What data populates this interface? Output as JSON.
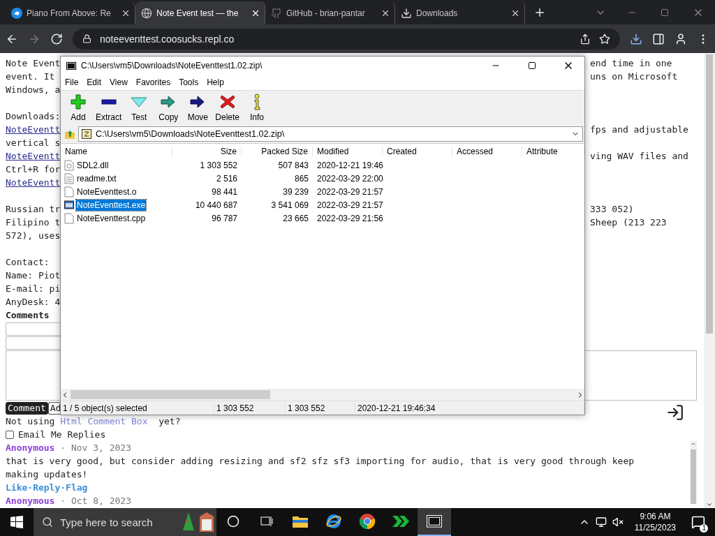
{
  "browser": {
    "tabs": [
      {
        "title": "Piano From Above: Re",
        "kind": "piano",
        "selected": false
      },
      {
        "title": "Note Event test — the",
        "kind": "globe",
        "selected": true
      },
      {
        "title": "GitHub - brian-pantar",
        "kind": "github",
        "selected": false
      },
      {
        "title": "Downloads",
        "kind": "download",
        "selected": false
      }
    ],
    "nav": [
      {
        "kind": "back",
        "disabled": false
      },
      {
        "kind": "forward",
        "disabled": true
      },
      {
        "kind": "reload",
        "disabled": false
      }
    ],
    "address": "noteeventtest.coosucks.repl.co"
  },
  "page": {
    "lines": [
      {
        "left": "Note Event",
        "kind": "text",
        "right": "end time in one"
      },
      {
        "left": "event. It",
        "kind": "text",
        "right": "uns on Microsoft"
      },
      {
        "left": "Windows, a",
        "kind": "text"
      },
      {
        "kind": "blank"
      },
      {
        "left": "Downloads:",
        "kind": "text"
      },
      {
        "left": "NoteEventt",
        "kind": "link",
        "right": "fps and adjustable"
      },
      {
        "left": "vertical s",
        "kind": "text"
      },
      {
        "left": "NoteEventt",
        "kind": "link",
        "right": "ving WAV files and"
      },
      {
        "left": "Ctrl+R for",
        "kind": "text"
      },
      {
        "left": "NoteEventt",
        "kind": "link"
      },
      {
        "kind": "blank"
      },
      {
        "left": "Russian tr",
        "kind": "text",
        "right": "333 052)"
      },
      {
        "left": "Filipino t",
        "kind": "text",
        "right": "Sheep (213 223"
      },
      {
        "left": "572), uses",
        "kind": "text"
      },
      {
        "kind": "blank"
      },
      {
        "left": "Contact:",
        "kind": "text"
      },
      {
        "left": "Name: Piot",
        "kind": "text"
      },
      {
        "left": "E-mail: pi",
        "kind": "text"
      },
      {
        "left": "AnyDesk: 4",
        "kind": "text"
      },
      {
        "left": "Comments",
        "kind": "heading"
      }
    ],
    "comment_button": "Comment",
    "add_button": "Ad",
    "not_using": {
      "before": "Not using ",
      "link": "Html Comment Box",
      "after": "  yet?"
    },
    "email_replies": {
      "label": "Email Me Replies",
      "checked": false
    },
    "comments": [
      {
        "author": "Anonymous",
        "date": "· Nov 3, 2023",
        "text": "that is very good, but consider adding resizing and sf2 sfz sf3 importing for audio, that is very good through keep making updates!",
        "actions": [
          "Like",
          "·Reply",
          "·Flag"
        ]
      },
      {
        "author": "Anonymous",
        "date": "· Oct 8, 2023"
      }
    ]
  },
  "window": {
    "title": "C:\\Users\\vm5\\Downloads\\NoteEventtest1.02.zip\\",
    "menu": [
      "File",
      "Edit",
      "View",
      "Favorites",
      "Tools",
      "Help"
    ],
    "toolbar": [
      {
        "label": "Add",
        "kind": "add"
      },
      {
        "label": "Extract",
        "kind": "extract"
      },
      {
        "label": "Test",
        "kind": "test"
      },
      {
        "label": "Copy",
        "kind": "copy"
      },
      {
        "label": "Move",
        "kind": "move"
      },
      {
        "label": "Delete",
        "kind": "delete"
      },
      {
        "label": "Info",
        "kind": "info"
      }
    ],
    "address": "C:\\Users\\vm5\\Downloads\\NoteEventtest1.02.zip\\",
    "columns": [
      "Name",
      "Size",
      "Packed Size",
      "Modified",
      "Created",
      "Accessed",
      "Attribute"
    ],
    "rows": [
      {
        "name": "SDL2.dll",
        "size": "1 303 552",
        "packed": "507 843",
        "modified": "2020-12-21 19:46",
        "kind": "dll",
        "selected": false
      },
      {
        "name": "readme.txt",
        "size": "2 516",
        "packed": "865",
        "modified": "2022-03-29 22:00",
        "kind": "text",
        "selected": false
      },
      {
        "name": "NoteEventtest.o",
        "size": "98 441",
        "packed": "39 239",
        "modified": "2022-03-29 21:57",
        "kind": "file",
        "selected": false
      },
      {
        "name": "NoteEventtest.exe",
        "size": "10 440 687",
        "packed": "3 541 069",
        "modified": "2022-03-29 21:57",
        "kind": "exe",
        "selected": true
      },
      {
        "name": "NoteEventtest.cpp",
        "size": "96 787",
        "packed": "23 665",
        "modified": "2022-03-29 21:56",
        "kind": "file",
        "selected": false
      }
    ],
    "status": [
      "1 / 5 object(s) selected",
      "1 303 552",
      "1 303 552",
      "2020-12-21 19:46:34"
    ]
  },
  "taskbar": {
    "search_placeholder": "Type here to search",
    "apps": [
      {
        "kind": "cortana",
        "active": false
      },
      {
        "kind": "taskview",
        "active": false
      },
      {
        "kind": "explorer",
        "active": false
      },
      {
        "kind": "ie",
        "active": false
      },
      {
        "kind": "chrome",
        "active": false
      },
      {
        "kind": "chevrons",
        "active": false
      },
      {
        "kind": "sevenzip",
        "active": true
      }
    ],
    "time": "9:06 AM",
    "date": "11/25/2023",
    "notifications": "1"
  }
}
